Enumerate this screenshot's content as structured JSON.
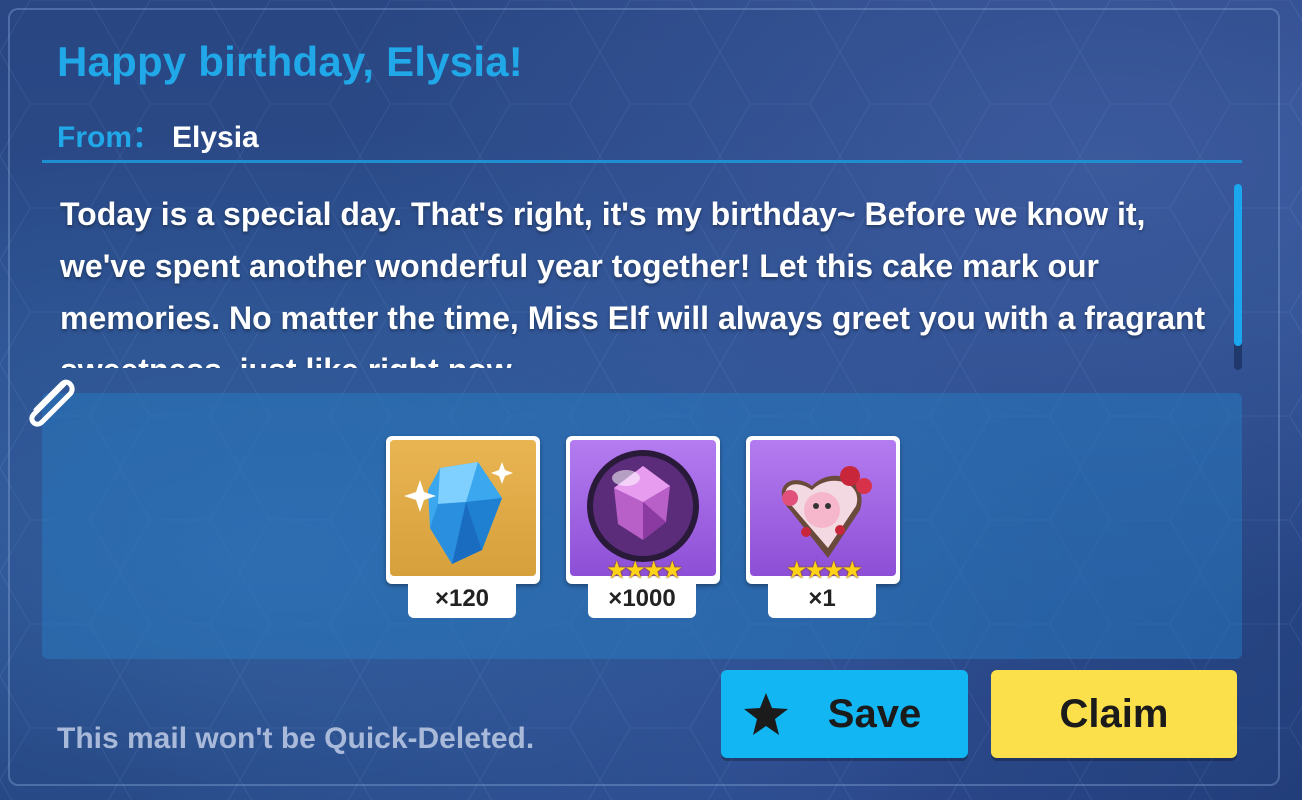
{
  "mail": {
    "title": "Happy birthday, Elysia!",
    "from_label": "From：",
    "from_value": "Elysia",
    "body": "Today is a special day. That's right, it's my birthday~ Before we know it, we've spent another wonderful year together! Let this cake mark our memories. No matter the time, Miss Elf will always greet you with a fragrant sweetness, just like right now~",
    "note": "This mail won't be Quick-Deleted."
  },
  "attachments": [
    {
      "icon": "crystal-icon",
      "rarity_color": "#e0ac48",
      "stars": "",
      "count": "×120"
    },
    {
      "icon": "purple-orb-icon",
      "rarity_color": "#9c5ee0",
      "stars": "★★★★",
      "count": "×1000"
    },
    {
      "icon": "birthday-cake-icon",
      "rarity_color": "#9c5ee0",
      "stars": "★★★★",
      "count": "×1"
    }
  ],
  "actions": {
    "save_label": "Save",
    "claim_label": "Claim"
  },
  "colors": {
    "accent": "#20a8e8",
    "save_button": "#12b6f2",
    "claim_button": "#fbe04b"
  }
}
